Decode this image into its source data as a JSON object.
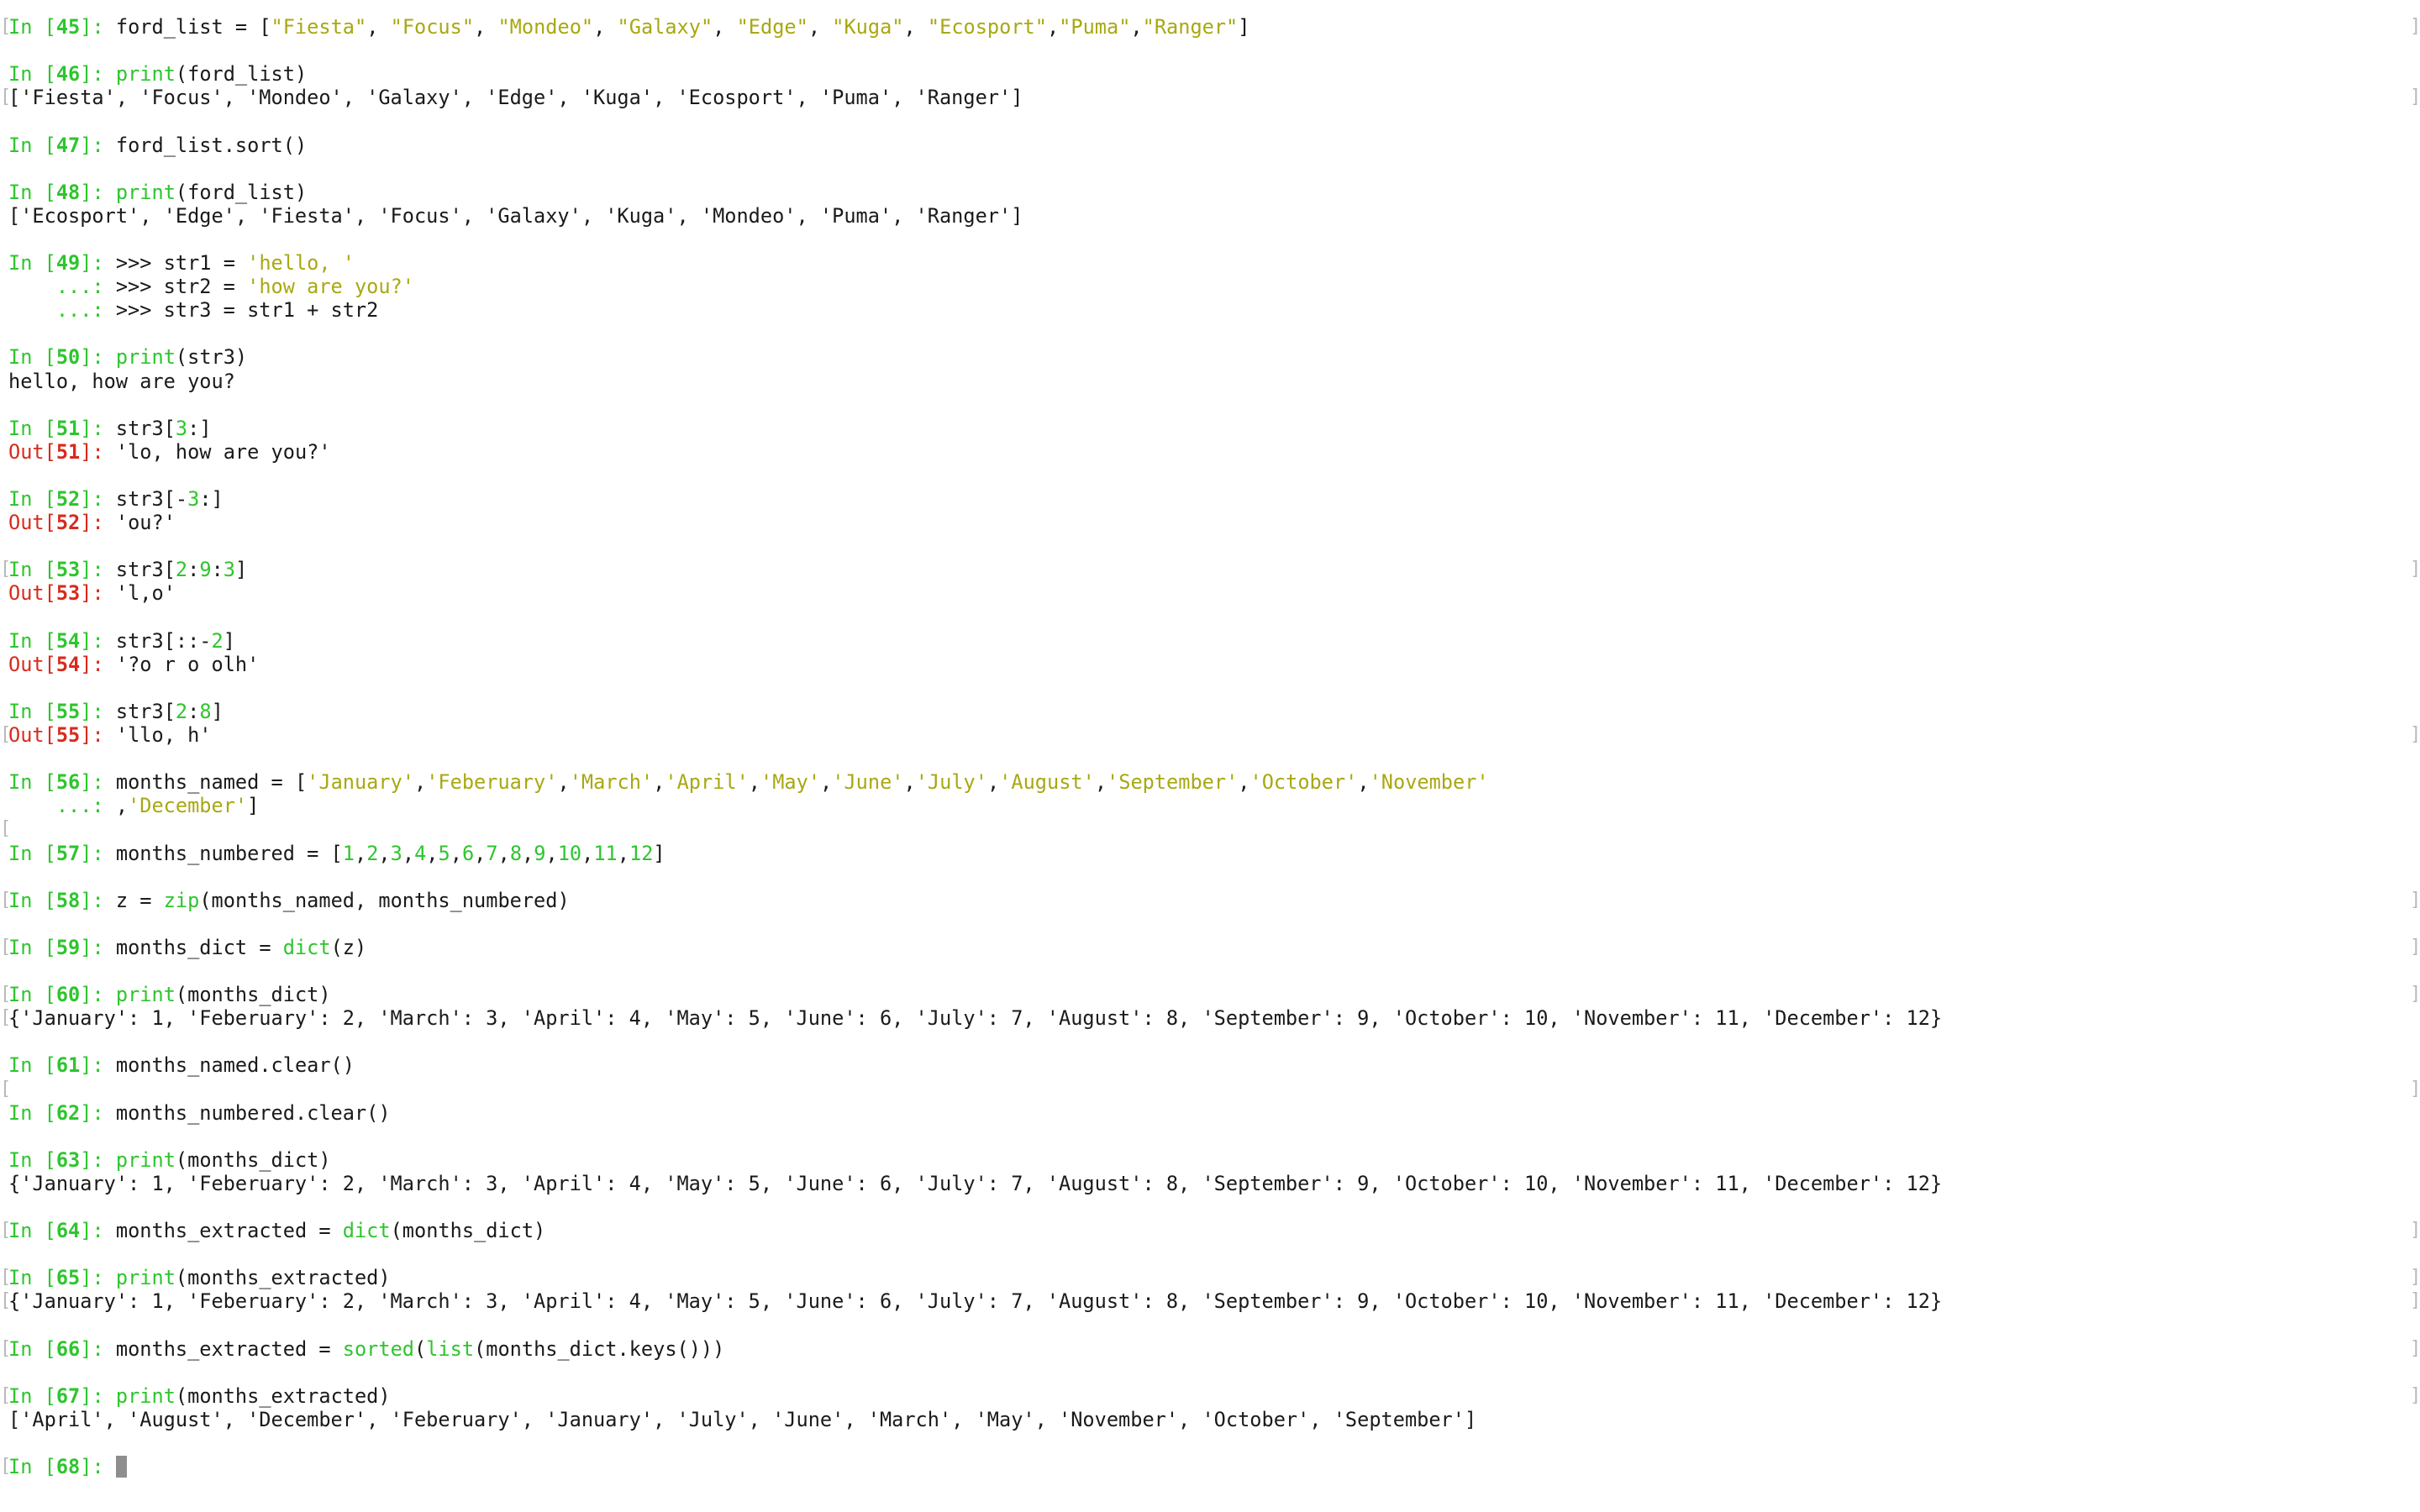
{
  "lines": [
    [
      {
        "t": "In [",
        "c": "p"
      },
      {
        "t": "45",
        "c": "pn"
      },
      {
        "t": "]: ",
        "c": "p"
      },
      {
        "t": "ford_list = ["
      },
      {
        "t": "\"Fiesta\"",
        "c": "s"
      },
      {
        "t": ", "
      },
      {
        "t": "\"Focus\"",
        "c": "s"
      },
      {
        "t": ", "
      },
      {
        "t": "\"Mondeo\"",
        "c": "s"
      },
      {
        "t": ", "
      },
      {
        "t": "\"Galaxy\"",
        "c": "s"
      },
      {
        "t": ", "
      },
      {
        "t": "\"Edge\"",
        "c": "s"
      },
      {
        "t": ", "
      },
      {
        "t": "\"Kuga\"",
        "c": "s"
      },
      {
        "t": ", "
      },
      {
        "t": "\"Ecosport\"",
        "c": "s"
      },
      {
        "t": ","
      },
      {
        "t": "\"Puma\"",
        "c": "s"
      },
      {
        "t": ","
      },
      {
        "t": "\"Ranger\"",
        "c": "s"
      },
      {
        "t": "]"
      }
    ],
    [],
    [
      {
        "t": "In [",
        "c": "p"
      },
      {
        "t": "46",
        "c": "pn"
      },
      {
        "t": "]: ",
        "c": "p"
      },
      {
        "t": "print",
        "c": "f"
      },
      {
        "t": "(ford_list)"
      }
    ],
    [
      {
        "t": "['Fiesta', 'Focus', 'Mondeo', 'Galaxy', 'Edge', 'Kuga', 'Ecosport', 'Puma', 'Ranger']"
      }
    ],
    [],
    [
      {
        "t": "In [",
        "c": "p"
      },
      {
        "t": "47",
        "c": "pn"
      },
      {
        "t": "]: ",
        "c": "p"
      },
      {
        "t": "ford_list.sort()"
      }
    ],
    [],
    [
      {
        "t": "In [",
        "c": "p"
      },
      {
        "t": "48",
        "c": "pn"
      },
      {
        "t": "]: ",
        "c": "p"
      },
      {
        "t": "print",
        "c": "f"
      },
      {
        "t": "(ford_list)"
      }
    ],
    [
      {
        "t": "['Ecosport', 'Edge', 'Fiesta', 'Focus', 'Galaxy', 'Kuga', 'Mondeo', 'Puma', 'Ranger']"
      }
    ],
    [],
    [
      {
        "t": "In [",
        "c": "p"
      },
      {
        "t": "49",
        "c": "pn"
      },
      {
        "t": "]: ",
        "c": "p"
      },
      {
        "t": ">>> str1 = "
      },
      {
        "t": "'hello, '",
        "c": "s"
      }
    ],
    [
      {
        "t": "    ...: ",
        "c": "p"
      },
      {
        "t": ">>> str2 = "
      },
      {
        "t": "'how are you?'",
        "c": "s"
      }
    ],
    [
      {
        "t": "    ...: ",
        "c": "p"
      },
      {
        "t": ">>> str3 = str1 + str2"
      }
    ],
    [],
    [
      {
        "t": "In [",
        "c": "p"
      },
      {
        "t": "50",
        "c": "pn"
      },
      {
        "t": "]: ",
        "c": "p"
      },
      {
        "t": "print",
        "c": "f"
      },
      {
        "t": "(str3)"
      }
    ],
    [
      {
        "t": "hello, how are you?"
      }
    ],
    [],
    [
      {
        "t": "In [",
        "c": "p"
      },
      {
        "t": "51",
        "c": "pn"
      },
      {
        "t": "]: ",
        "c": "p"
      },
      {
        "t": "str3["
      },
      {
        "t": "3",
        "c": "n"
      },
      {
        "t": ":]"
      }
    ],
    [
      {
        "t": "Out[",
        "c": "o"
      },
      {
        "t": "51",
        "c": "on"
      },
      {
        "t": "]: ",
        "c": "o"
      },
      {
        "t": "'lo, how are you?'"
      }
    ],
    [],
    [
      {
        "t": "In [",
        "c": "p"
      },
      {
        "t": "52",
        "c": "pn"
      },
      {
        "t": "]: ",
        "c": "p"
      },
      {
        "t": "str3[-"
      },
      {
        "t": "3",
        "c": "n"
      },
      {
        "t": ":]"
      }
    ],
    [
      {
        "t": "Out[",
        "c": "o"
      },
      {
        "t": "52",
        "c": "on"
      },
      {
        "t": "]: ",
        "c": "o"
      },
      {
        "t": "'ou?'"
      }
    ],
    [],
    [
      {
        "t": "In [",
        "c": "p"
      },
      {
        "t": "53",
        "c": "pn"
      },
      {
        "t": "]: ",
        "c": "p"
      },
      {
        "t": "str3["
      },
      {
        "t": "2",
        "c": "n"
      },
      {
        "t": ":"
      },
      {
        "t": "9",
        "c": "n"
      },
      {
        "t": ":"
      },
      {
        "t": "3",
        "c": "n"
      },
      {
        "t": "]"
      }
    ],
    [
      {
        "t": "Out[",
        "c": "o"
      },
      {
        "t": "53",
        "c": "on"
      },
      {
        "t": "]: ",
        "c": "o"
      },
      {
        "t": "'l,o'"
      }
    ],
    [],
    [
      {
        "t": "In [",
        "c": "p"
      },
      {
        "t": "54",
        "c": "pn"
      },
      {
        "t": "]: ",
        "c": "p"
      },
      {
        "t": "str3[::-"
      },
      {
        "t": "2",
        "c": "n"
      },
      {
        "t": "]"
      }
    ],
    [
      {
        "t": "Out[",
        "c": "o"
      },
      {
        "t": "54",
        "c": "on"
      },
      {
        "t": "]: ",
        "c": "o"
      },
      {
        "t": "'?o r o olh'"
      }
    ],
    [],
    [
      {
        "t": "In [",
        "c": "p"
      },
      {
        "t": "55",
        "c": "pn"
      },
      {
        "t": "]: ",
        "c": "p"
      },
      {
        "t": "str3["
      },
      {
        "t": "2",
        "c": "n"
      },
      {
        "t": ":"
      },
      {
        "t": "8",
        "c": "n"
      },
      {
        "t": "]"
      }
    ],
    [
      {
        "t": "Out[",
        "c": "o"
      },
      {
        "t": "55",
        "c": "on"
      },
      {
        "t": "]: ",
        "c": "o"
      },
      {
        "t": "'llo, h'"
      }
    ],
    [],
    [
      {
        "t": "In [",
        "c": "p"
      },
      {
        "t": "56",
        "c": "pn"
      },
      {
        "t": "]: ",
        "c": "p"
      },
      {
        "t": "months_named = ["
      },
      {
        "t": "'January'",
        "c": "s"
      },
      {
        "t": ","
      },
      {
        "t": "'Feberuary'",
        "c": "s"
      },
      {
        "t": ","
      },
      {
        "t": "'March'",
        "c": "s"
      },
      {
        "t": ","
      },
      {
        "t": "'April'",
        "c": "s"
      },
      {
        "t": ","
      },
      {
        "t": "'May'",
        "c": "s"
      },
      {
        "t": ","
      },
      {
        "t": "'June'",
        "c": "s"
      },
      {
        "t": ","
      },
      {
        "t": "'July'",
        "c": "s"
      },
      {
        "t": ","
      },
      {
        "t": "'August'",
        "c": "s"
      },
      {
        "t": ","
      },
      {
        "t": "'September'",
        "c": "s"
      },
      {
        "t": ","
      },
      {
        "t": "'October'",
        "c": "s"
      },
      {
        "t": ","
      },
      {
        "t": "'November'",
        "c": "s"
      }
    ],
    [
      {
        "t": "    ...: ",
        "c": "p"
      },
      {
        "t": ","
      },
      {
        "t": "'December'",
        "c": "s"
      },
      {
        "t": "]"
      }
    ],
    [],
    [
      {
        "t": "In [",
        "c": "p"
      },
      {
        "t": "57",
        "c": "pn"
      },
      {
        "t": "]: ",
        "c": "p"
      },
      {
        "t": "months_numbered = ["
      },
      {
        "t": "1",
        "c": "n"
      },
      {
        "t": ","
      },
      {
        "t": "2",
        "c": "n"
      },
      {
        "t": ","
      },
      {
        "t": "3",
        "c": "n"
      },
      {
        "t": ","
      },
      {
        "t": "4",
        "c": "n"
      },
      {
        "t": ","
      },
      {
        "t": "5",
        "c": "n"
      },
      {
        "t": ","
      },
      {
        "t": "6",
        "c": "n"
      },
      {
        "t": ","
      },
      {
        "t": "7",
        "c": "n"
      },
      {
        "t": ","
      },
      {
        "t": "8",
        "c": "n"
      },
      {
        "t": ","
      },
      {
        "t": "9",
        "c": "n"
      },
      {
        "t": ","
      },
      {
        "t": "10",
        "c": "n"
      },
      {
        "t": ","
      },
      {
        "t": "11",
        "c": "n"
      },
      {
        "t": ","
      },
      {
        "t": "12",
        "c": "n"
      },
      {
        "t": "]"
      }
    ],
    [],
    [
      {
        "t": "In [",
        "c": "p"
      },
      {
        "t": "58",
        "c": "pn"
      },
      {
        "t": "]: ",
        "c": "p"
      },
      {
        "t": "z = "
      },
      {
        "t": "zip",
        "c": "f"
      },
      {
        "t": "(months_named, months_numbered)"
      }
    ],
    [],
    [
      {
        "t": "In [",
        "c": "p"
      },
      {
        "t": "59",
        "c": "pn"
      },
      {
        "t": "]: ",
        "c": "p"
      },
      {
        "t": "months_dict = "
      },
      {
        "t": "dict",
        "c": "f"
      },
      {
        "t": "(z)"
      }
    ],
    [],
    [
      {
        "t": "In [",
        "c": "p"
      },
      {
        "t": "60",
        "c": "pn"
      },
      {
        "t": "]: ",
        "c": "p"
      },
      {
        "t": "print",
        "c": "f"
      },
      {
        "t": "(months_dict)"
      }
    ],
    [
      {
        "t": "{'January': 1, 'Feberuary': 2, 'March': 3, 'April': 4, 'May': 5, 'June': 6, 'July': 7, 'August': 8, 'September': 9, 'October': 10, 'November': 11, 'December': 12}"
      }
    ],
    [],
    [
      {
        "t": "In [",
        "c": "p"
      },
      {
        "t": "61",
        "c": "pn"
      },
      {
        "t": "]: ",
        "c": "p"
      },
      {
        "t": "months_named.clear()"
      }
    ],
    [],
    [
      {
        "t": "In [",
        "c": "p"
      },
      {
        "t": "62",
        "c": "pn"
      },
      {
        "t": "]: ",
        "c": "p"
      },
      {
        "t": "months_numbered.clear()"
      }
    ],
    [],
    [
      {
        "t": "In [",
        "c": "p"
      },
      {
        "t": "63",
        "c": "pn"
      },
      {
        "t": "]: ",
        "c": "p"
      },
      {
        "t": "print",
        "c": "f"
      },
      {
        "t": "(months_dict)"
      }
    ],
    [
      {
        "t": "{'January': 1, 'Feberuary': 2, 'March': 3, 'April': 4, 'May': 5, 'June': 6, 'July': 7, 'August': 8, 'September': 9, 'October': 10, 'November': 11, 'December': 12}"
      }
    ],
    [],
    [
      {
        "t": "In [",
        "c": "p"
      },
      {
        "t": "64",
        "c": "pn"
      },
      {
        "t": "]: ",
        "c": "p"
      },
      {
        "t": "months_extracted = "
      },
      {
        "t": "dict",
        "c": "f"
      },
      {
        "t": "(months_dict)"
      }
    ],
    [],
    [
      {
        "t": "In [",
        "c": "p"
      },
      {
        "t": "65",
        "c": "pn"
      },
      {
        "t": "]: ",
        "c": "p"
      },
      {
        "t": "print",
        "c": "f"
      },
      {
        "t": "(months_extracted)"
      }
    ],
    [
      {
        "t": "{'January': 1, 'Feberuary': 2, 'March': 3, 'April': 4, 'May': 5, 'June': 6, 'July': 7, 'August': 8, 'September': 9, 'October': 10, 'November': 11, 'December': 12}"
      }
    ],
    [],
    [
      {
        "t": "In [",
        "c": "p"
      },
      {
        "t": "66",
        "c": "pn"
      },
      {
        "t": "]: ",
        "c": "p"
      },
      {
        "t": "months_extracted = "
      },
      {
        "t": "sorted",
        "c": "f"
      },
      {
        "t": "("
      },
      {
        "t": "list",
        "c": "f"
      },
      {
        "t": "(months_dict.keys()))"
      }
    ],
    [],
    [
      {
        "t": "In [",
        "c": "p"
      },
      {
        "t": "67",
        "c": "pn"
      },
      {
        "t": "]: ",
        "c": "p"
      },
      {
        "t": "print",
        "c": "f"
      },
      {
        "t": "(months_extracted)"
      }
    ],
    [
      {
        "t": "['April', 'August', 'December', 'Feberuary', 'January', 'July', 'June', 'March', 'May', 'November', 'October', 'September']"
      }
    ],
    [],
    [
      {
        "t": "In [",
        "c": "p"
      },
      {
        "t": "68",
        "c": "pn"
      },
      {
        "t": "]: ",
        "c": "p"
      }
    ]
  ],
  "brackets_left": [
    0,
    3,
    23,
    30,
    34,
    37,
    39,
    41,
    42,
    45,
    51,
    53,
    54,
    56,
    58,
    61
  ],
  "brackets_right": [
    0,
    3,
    23,
    30,
    37,
    39,
    41,
    45,
    51,
    53,
    54,
    56,
    58
  ],
  "cursor_line": 61
}
